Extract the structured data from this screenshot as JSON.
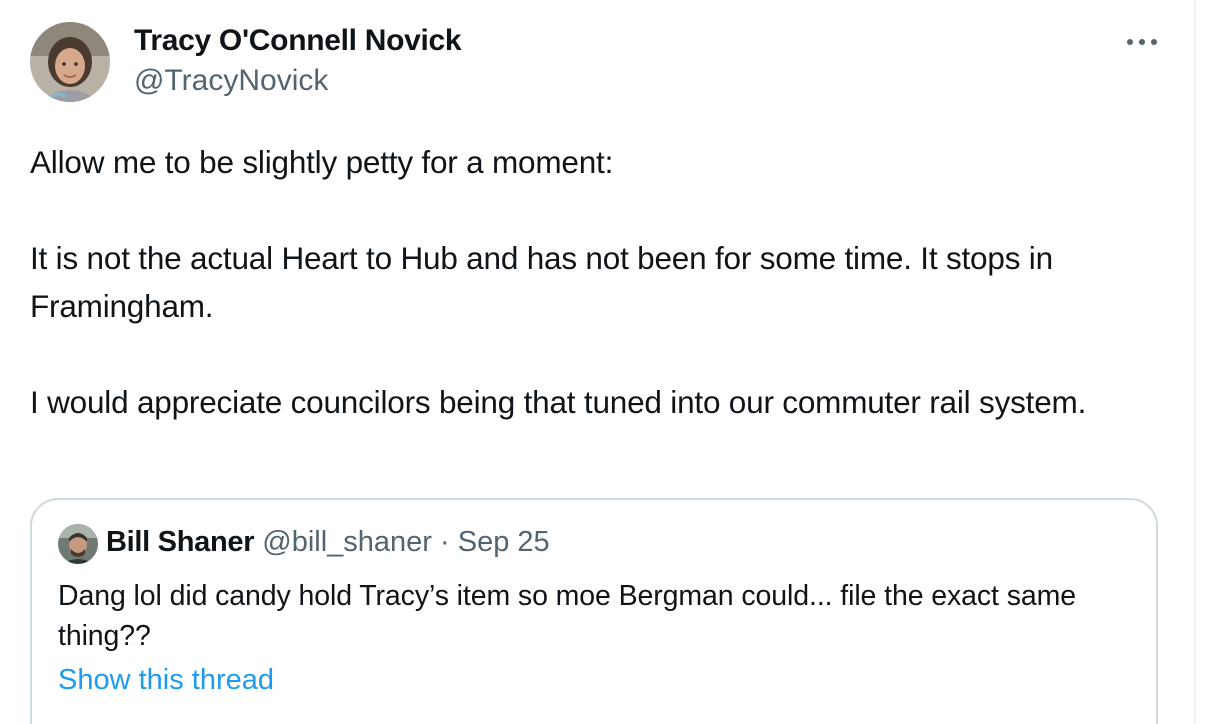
{
  "tweet": {
    "author": {
      "name": "Tracy O'Connell Novick",
      "handle": "@TracyNovick"
    },
    "paragraphs": [
      "Allow me to be slightly petty for a moment:",
      "It is not the actual Heart to Hub and has not been for some time. It stops in Framingham.",
      "I would appreciate councilors being that tuned into our commuter rail system."
    ],
    "more_icon": "ellipsis-icon"
  },
  "quoted_tweet": {
    "author": {
      "name": "Bill Shaner",
      "handle": "@bill_shaner"
    },
    "separator": "·",
    "date": "Sep 25",
    "text": "Dang lol did candy hold Tracy’s item so moe Bergman could... file the exact same thing??",
    "show_thread_label": "Show this thread"
  },
  "colors": {
    "primary_text": "#0f1419",
    "secondary_text": "#536471",
    "link": "#1d9bf0",
    "border": "#cfd9de"
  }
}
